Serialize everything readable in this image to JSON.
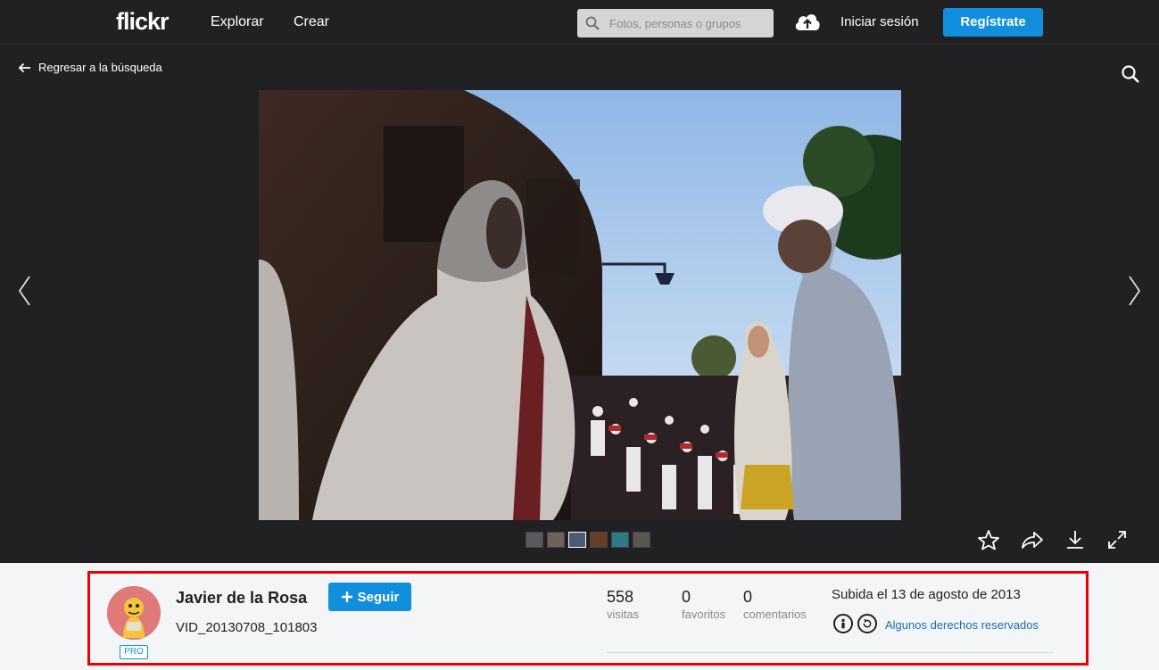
{
  "nav": {
    "logo": "flickr",
    "explore": "Explorar",
    "create": "Crear",
    "search_placeholder": "Fotos, personas o grupos",
    "login": "Iniciar sesión",
    "signup": "Regístrate"
  },
  "viewer": {
    "back_label": "Regresar a la búsqueda"
  },
  "info": {
    "owner": "Javier de la Rosa",
    "pro_badge": "PRO",
    "follow_label": "Seguir",
    "photo_title": "VID_20130708_101803",
    "stats": [
      {
        "value": "558",
        "label": "visitas"
      },
      {
        "value": "0",
        "label": "favoritos"
      },
      {
        "value": "0",
        "label": "comentarios"
      }
    ],
    "uploaded": "Subida el 13 de agosto de 2013",
    "license": "Algunos derechos reservados"
  },
  "colors": {
    "accent": "#128fdc",
    "highlight": "#ee0000",
    "dark_bg": "#212124"
  }
}
